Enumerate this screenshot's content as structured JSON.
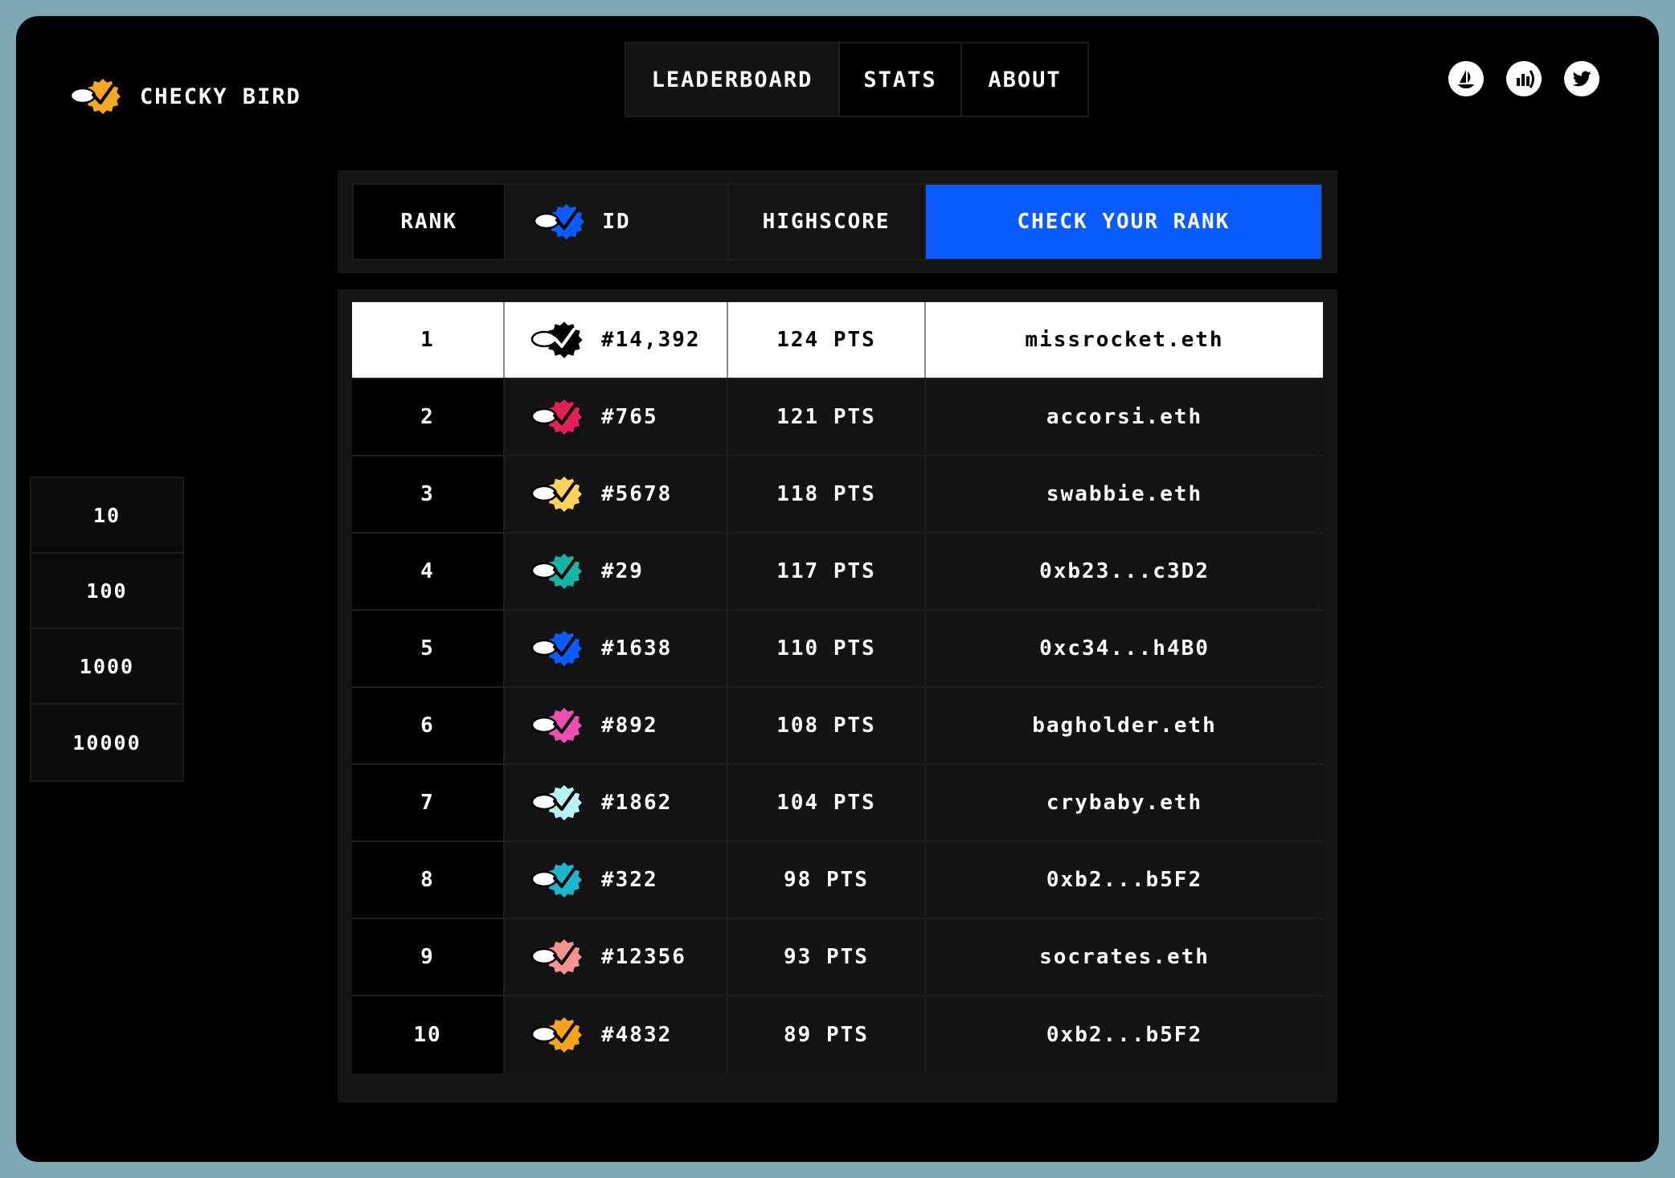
{
  "brand": {
    "name": "CHECKY BIRD",
    "icon": "checky-bird-logo-icon",
    "color": "#f5a623"
  },
  "nav": {
    "tabs": [
      {
        "label": "LEADERBOARD",
        "active": true
      },
      {
        "label": "STATS",
        "active": false
      },
      {
        "label": "ABOUT",
        "active": false
      }
    ]
  },
  "socials": [
    {
      "name": "opensea-icon"
    },
    {
      "name": "stats-chart-icon"
    },
    {
      "name": "twitter-icon"
    }
  ],
  "filter": {
    "options": [
      "10",
      "100",
      "1000",
      "10000"
    ]
  },
  "table": {
    "headers": {
      "rank": "RANK",
      "id": "ID",
      "highscore": "HIGHSCORE",
      "cta": "CHECK YOUR RANK"
    },
    "header_icon_color": "#0a5cff",
    "cta_color": "#0a5cff",
    "rows": [
      {
        "rank": "1",
        "id": "#14,392",
        "score": "124 PTS",
        "name": "missrocket.eth",
        "color": "#000000"
      },
      {
        "rank": "2",
        "id": "#765",
        "score": "121 PTS",
        "name": "accorsi.eth",
        "color": "#e31f5a"
      },
      {
        "rank": "3",
        "id": "#5678",
        "score": "118 PTS",
        "name": "swabbie.eth",
        "color": "#ffd25e"
      },
      {
        "rank": "4",
        "id": "#29",
        "score": "117 PTS",
        "name": "0xb23...c3D2",
        "color": "#17b3a6"
      },
      {
        "rank": "5",
        "id": "#1638",
        "score": "110 PTS",
        "name": "0xc34...h4B0",
        "color": "#0a5cff"
      },
      {
        "rank": "6",
        "id": "#892",
        "score": "108 PTS",
        "name": "bagholder.eth",
        "color": "#ec4fb1"
      },
      {
        "rank": "7",
        "id": "#1862",
        "score": "104 PTS",
        "name": "crybaby.eth",
        "color": "#b6f3f4"
      },
      {
        "rank": "8",
        "id": "#322",
        "score": "98 PTS",
        "name": "0xb2...b5F2",
        "color": "#1eb4cc"
      },
      {
        "rank": "9",
        "id": "#12356",
        "score": "93 PTS",
        "name": "socrates.eth",
        "color": "#f6928f"
      },
      {
        "rank": "10",
        "id": "#4832",
        "score": "89 PTS",
        "name": "0xb2...b5F2",
        "color": "#f7a21b"
      }
    ]
  }
}
